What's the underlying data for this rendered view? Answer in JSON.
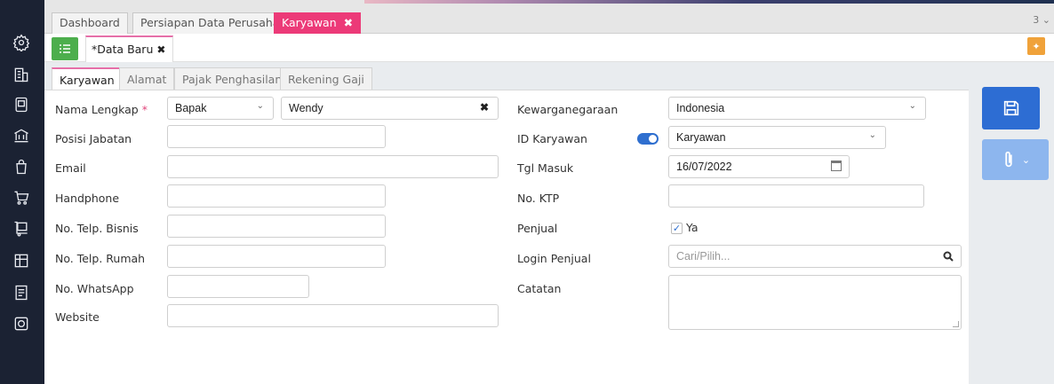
{
  "top_tabs": [
    {
      "label": "Dashboard"
    },
    {
      "label": "Persiapan Data Perusahaan"
    },
    {
      "label": "Karyawan",
      "close": "✖"
    }
  ],
  "tab_count": "3 ⌄",
  "doc_tab": {
    "label": "*Data Baru",
    "close": "✖"
  },
  "sub_tabs": [
    "Karyawan",
    "Alamat",
    "Pajak Penghasilan",
    "Rekening Gaji"
  ],
  "left": {
    "nama_lengkap_label": "Nama Lengkap",
    "required_mark": "*",
    "salutation": "Bapak",
    "name_value": "Wendy",
    "posisi_label": "Posisi Jabatan",
    "email_label": "Email",
    "handphone_label": "Handphone",
    "telp_bisnis_label": "No. Telp. Bisnis",
    "telp_rumah_label": "No. Telp. Rumah",
    "whatsapp_label": "No. WhatsApp",
    "website_label": "Website"
  },
  "right": {
    "kewarganegaraan_label": "Kewarganegaraan",
    "kewarganegaraan_value": "Indonesia",
    "id_karyawan_label": "ID Karyawan",
    "id_karyawan_value": "Karyawan",
    "tgl_masuk_label": "Tgl Masuk",
    "tgl_masuk_value": "16/07/2022",
    "ktp_label": "No. KTP",
    "penjual_label": "Penjual",
    "penjual_check_label": "Ya",
    "login_penjual_label": "Login Penjual",
    "login_penjual_placeholder": "Cari/Pilih...",
    "catatan_label": "Catatan"
  },
  "colors": {
    "accent": "#ec3a78",
    "primary": "#2d6dd3",
    "sidebar": "#1b2233"
  }
}
